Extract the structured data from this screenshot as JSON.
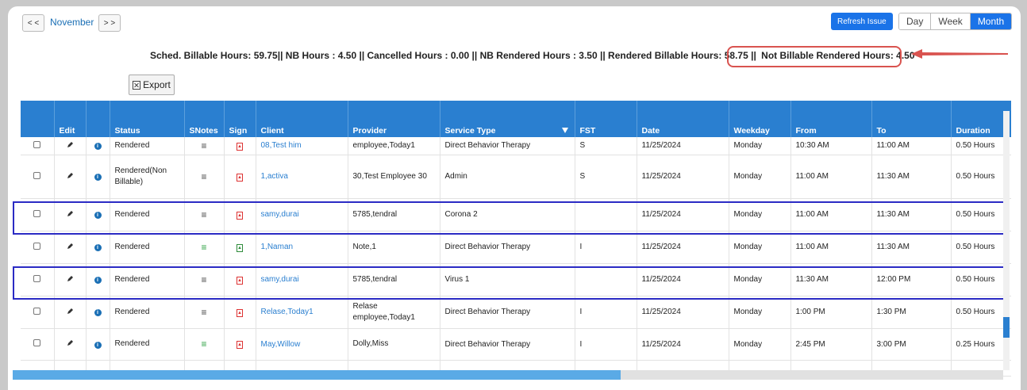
{
  "nav": {
    "prev": "< <",
    "month": "November",
    "next": "> >"
  },
  "toolbar": {
    "refresh": "Refresh Issue",
    "views": [
      "Day",
      "Week",
      "Month"
    ],
    "active_view": "Month"
  },
  "summary": {
    "text": "Sched. Billable Hours: 59.75|| NB Hours : 4.50 || Cancelled Hours : 0.00 || NB Rendered Hours : 3.50 || Rendered Billable Hours: 58.75 ||",
    "highlight": "Not Billable Rendered Hours: 4.50"
  },
  "export_label": "Export",
  "columns": [
    "",
    "Edit",
    "",
    "Status",
    "SNotes",
    "Sign",
    "Client",
    "Provider",
    "Service Type",
    "FST",
    "Date",
    "Weekday",
    "From",
    "To",
    "Duration"
  ],
  "rows": [
    {
      "status": "Rendered",
      "snotes_color": "gray",
      "sign_color": "red",
      "client": "08,Test him",
      "provider": "employee,Today1",
      "service": "Direct Behavior Therapy",
      "fst": "S",
      "date": "11/25/2024",
      "weekday": "Monday",
      "from": "10:30 AM",
      "to": "11:00 AM",
      "duration": "0.50 Hours"
    },
    {
      "status": "Rendered(Non Billable)",
      "snotes_color": "gray",
      "sign_color": "red",
      "client": "1,activa",
      "provider": "30,Test Employee 30",
      "service": "Admin",
      "fst": "S",
      "date": "11/25/2024",
      "weekday": "Monday",
      "from": "11:00 AM",
      "to": "11:30 AM",
      "duration": "0.50 Hours"
    },
    {
      "status": "Rendered",
      "snotes_color": "gray",
      "sign_color": "red",
      "client": "samy,durai",
      "provider": "5785,tendral",
      "service": "Corona 2",
      "fst": "",
      "date": "11/25/2024",
      "weekday": "Monday",
      "from": "11:00 AM",
      "to": "11:30 AM",
      "duration": "0.50 Hours"
    },
    {
      "status": "Rendered",
      "snotes_color": "green",
      "sign_color": "green",
      "client": "1,Naman",
      "provider": "Note,1",
      "service": "Direct Behavior Therapy",
      "fst": "I",
      "date": "11/25/2024",
      "weekday": "Monday",
      "from": "11:00 AM",
      "to": "11:30 AM",
      "duration": "0.50 Hours"
    },
    {
      "status": "Rendered",
      "snotes_color": "gray",
      "sign_color": "red",
      "client": "samy,durai",
      "provider": "5785,tendral",
      "service": "Virus 1",
      "fst": "",
      "date": "11/25/2024",
      "weekday": "Monday",
      "from": "11:30 AM",
      "to": "12:00 PM",
      "duration": "0.50 Hours"
    },
    {
      "status": "Rendered",
      "snotes_color": "gray",
      "sign_color": "red",
      "client": "Relase,Today1",
      "provider": "Relase employee,Today1",
      "service": "Direct Behavior Therapy",
      "fst": "I",
      "date": "11/25/2024",
      "weekday": "Monday",
      "from": "1:00 PM",
      "to": "1:30 PM",
      "duration": "0.50 Hours"
    },
    {
      "status": "Rendered",
      "snotes_color": "green",
      "sign_color": "red",
      "client": "May,Willow",
      "provider": "Dolly,Miss",
      "service": "Direct Behavior Therapy",
      "fst": "I",
      "date": "11/25/2024",
      "weekday": "Monday",
      "from": "2:45 PM",
      "to": "3:00 PM",
      "duration": "0.25 Hours"
    }
  ],
  "colors": {
    "header": "#2a7fd0",
    "accent": "#1a73e8",
    "highlight": "#d9534f",
    "outline": "#2b2bc4"
  }
}
